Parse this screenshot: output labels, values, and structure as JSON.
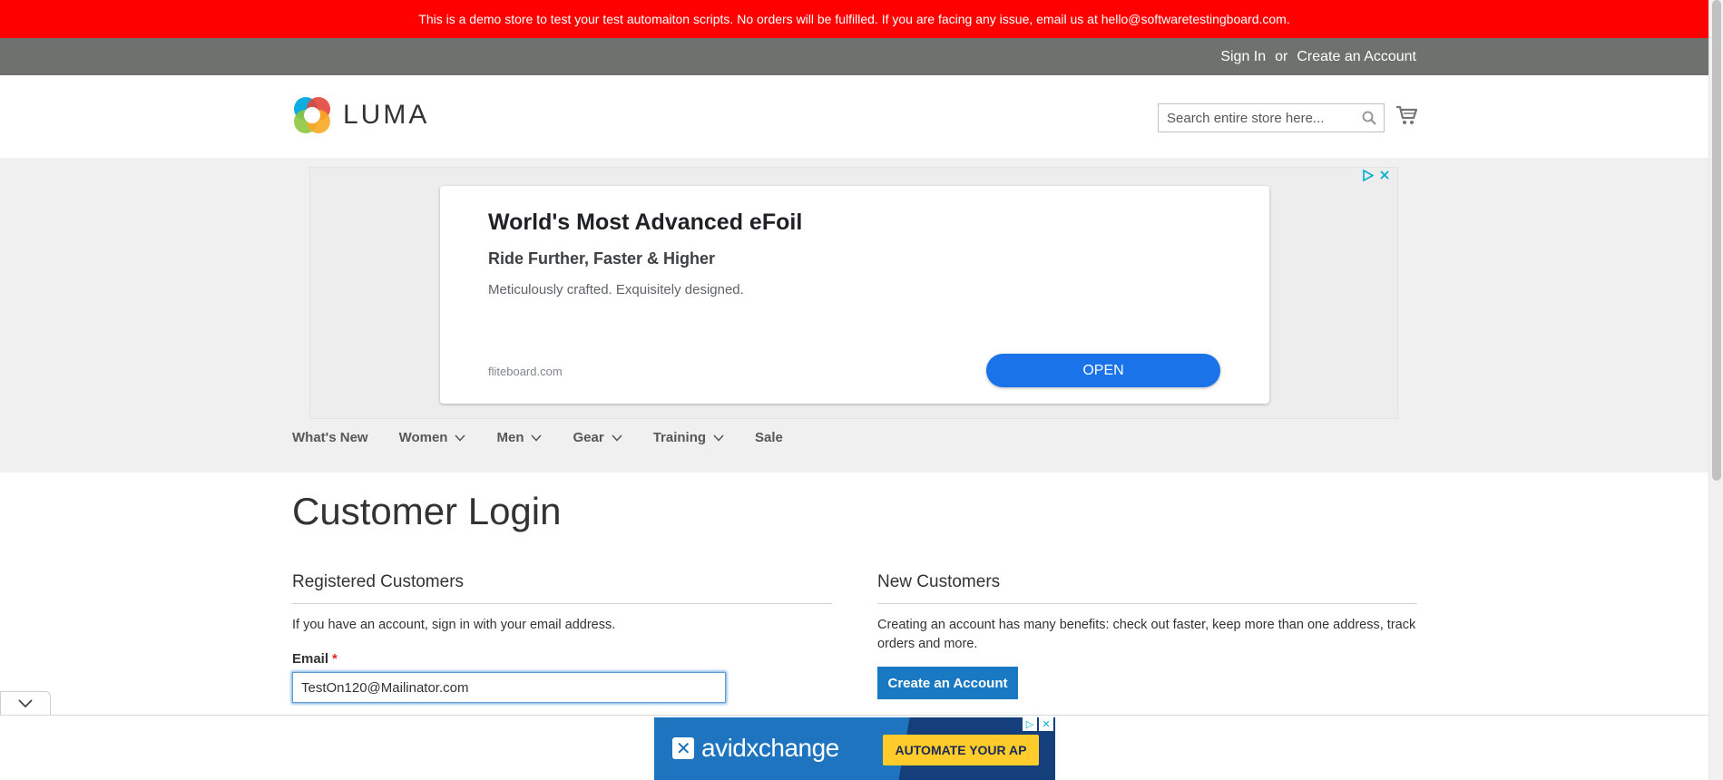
{
  "demo_banner": {
    "text": "This is a demo store to test your test automaiton scripts. No orders will be fulfilled. If you are facing any issue, email us at hello@softwaretestingboard.com."
  },
  "top_links": {
    "sign_in": "Sign In",
    "or": "or",
    "create_account": "Create an Account"
  },
  "header": {
    "logo_text": "LUMA",
    "search_placeholder": "Search entire store here...",
    "search_icon": "search-icon",
    "cart_icon": "cart-icon"
  },
  "ad": {
    "title": "World's Most Advanced eFoil",
    "subtitle": "Ride Further, Faster & Higher",
    "description": "Meticulously crafted. Exquisitely designed.",
    "domain": "fliteboard.com",
    "cta": "OPEN",
    "adchoices_icon": "adchoices-icon",
    "close_icon": "close-icon"
  },
  "nav": {
    "items": [
      {
        "label": "What's New",
        "has_dropdown": false
      },
      {
        "label": "Women",
        "has_dropdown": true
      },
      {
        "label": "Men",
        "has_dropdown": true
      },
      {
        "label": "Gear",
        "has_dropdown": true
      },
      {
        "label": "Training",
        "has_dropdown": true
      },
      {
        "label": "Sale",
        "has_dropdown": false
      }
    ]
  },
  "main": {
    "page_title": "Customer Login",
    "registered": {
      "title": "Registered Customers",
      "intro": "If you have an account, sign in with your email address.",
      "email_label": "Email",
      "required_mark": "*",
      "email_value": "TestOn120@Mailinator.com"
    },
    "new_customers": {
      "title": "New Customers",
      "text": "Creating an account has many benefits: check out faster, keep more than one address, track orders and more.",
      "button": "Create an Account"
    }
  },
  "bottom_ad": {
    "brand": "avidxchange",
    "cta": "AUTOMATE YOUR AP"
  },
  "colors": {
    "banner_red": "#ff0000",
    "topbar_grey": "#6e716e",
    "primary_blue": "#1979c3",
    "ad_open_blue": "#1a73e8",
    "required_red": "#e02b27"
  }
}
